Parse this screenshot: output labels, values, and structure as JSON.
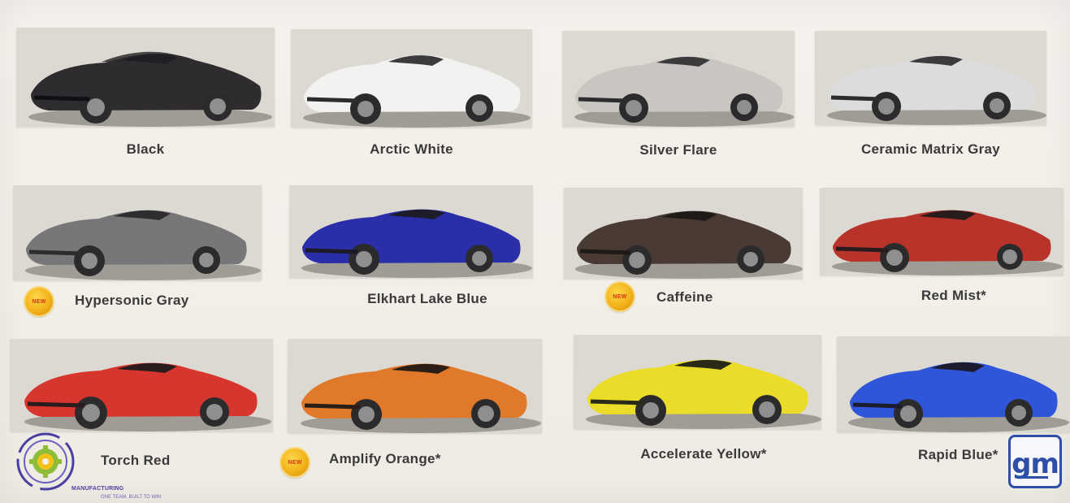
{
  "colors": [
    {
      "name": "Black",
      "paint": "#2e2c2e",
      "is_new": false
    },
    {
      "name": "Arctic White",
      "paint": "#f2f2f0",
      "is_new": false
    },
    {
      "name": "Silver Flare",
      "paint": "#c9c6c1",
      "is_new": false
    },
    {
      "name": "Ceramic Matrix Gray",
      "paint": "#dcdcdc",
      "is_new": false
    },
    {
      "name": "Hypersonic Gray",
      "paint": "#77777a",
      "is_new": true
    },
    {
      "name": "Elkhart Lake Blue",
      "paint": "#2a2ea8",
      "is_new": false
    },
    {
      "name": "Caffeine",
      "paint": "#4a3a34",
      "is_new": true
    },
    {
      "name": "Red Mist*",
      "paint": "#b8342a",
      "is_new": false
    },
    {
      "name": "Torch Red",
      "paint": "#d6362d",
      "is_new": false
    },
    {
      "name": "Amplify Orange*",
      "paint": "#e07a2a",
      "is_new": true
    },
    {
      "name": "Accelerate Yellow*",
      "paint": "#eadc28",
      "is_new": false
    },
    {
      "name": "Rapid Blue*",
      "paint": "#2f55d8",
      "is_new": false
    }
  ],
  "badge": {
    "text": "NEW"
  },
  "logos": {
    "left": {
      "text": "MANUFACTURING",
      "subtext": "ONE TEAM. BUILT TO WIN"
    },
    "right": {
      "text": "gm"
    }
  }
}
